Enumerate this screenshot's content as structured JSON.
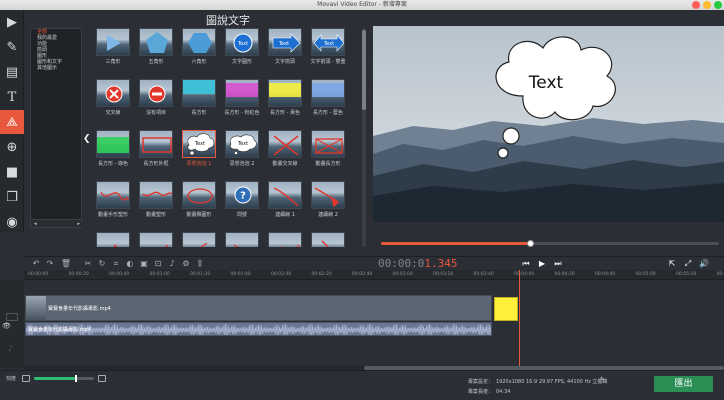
{
  "window": {
    "title": "Movavi Video Editor - 新增專案"
  },
  "panel": {
    "title": "圖說文字",
    "categories": [
      {
        "label": "全部",
        "selected": true
      },
      {
        "label": "我的最愛",
        "selected": false
      },
      {
        "label": "功能",
        "selected": false
      },
      {
        "label": "箭頭",
        "selected": false
      },
      {
        "label": "圖形",
        "selected": false
      },
      {
        "label": "圖形和文字",
        "selected": false
      },
      {
        "label": "其他圖示",
        "selected": false
      }
    ],
    "tiles": [
      {
        "label": "三角形",
        "kind": "triangle"
      },
      {
        "label": "五角形",
        "kind": "pentagon"
      },
      {
        "label": "六角形",
        "kind": "hexagon"
      },
      {
        "label": "文字圓形",
        "kind": "textcircle"
      },
      {
        "label": "文字箭頭",
        "kind": "textarrow"
      },
      {
        "label": "文字箭頭 - 雙重",
        "kind": "textarrow2"
      },
      {
        "label": "交叉線",
        "kind": "xcircle"
      },
      {
        "label": "沒有項目",
        "kind": "nogo"
      },
      {
        "label": "長方形",
        "kind": "rect-cyan"
      },
      {
        "label": "長方形 - 粉紅色",
        "kind": "rect-pink"
      },
      {
        "label": "長方形 - 黃色",
        "kind": "rect-yellow"
      },
      {
        "label": "長方形 - 藍色",
        "kind": "rect-blue"
      },
      {
        "label": "長方形 - 綠色",
        "kind": "rect-green"
      },
      {
        "label": "長方形外框",
        "kind": "rect-outline"
      },
      {
        "label": "思想泡泡 1",
        "kind": "bubble1",
        "selected": true
      },
      {
        "label": "思想泡泡 2",
        "kind": "bubble2"
      },
      {
        "label": "動畫交叉線",
        "kind": "xlines"
      },
      {
        "label": "動畫長方形",
        "kind": "xrect"
      },
      {
        "label": "動畫手形塑形",
        "kind": "scribble1"
      },
      {
        "label": "動畫塑形",
        "kind": "scribble2"
      },
      {
        "label": "動畫橢圓形",
        "kind": "oval"
      },
      {
        "label": "問號",
        "kind": "question"
      },
      {
        "label": "連續線 1",
        "kind": "line1"
      },
      {
        "label": "連續線 2",
        "kind": "line2"
      },
      {
        "label": "",
        "kind": "arrow-a"
      },
      {
        "label": "",
        "kind": "arrow-b"
      },
      {
        "label": "",
        "kind": "arrow-c"
      },
      {
        "label": "",
        "kind": "arrow-d"
      },
      {
        "label": "",
        "kind": "arrow-e"
      },
      {
        "label": "",
        "kind": "arrow-f"
      }
    ]
  },
  "preview": {
    "bubble_text": "Text"
  },
  "player": {
    "time_gray": "00:00:0",
    "time_red": "1.345",
    "progress": 0.44
  },
  "ruler": [
    "00:00:00",
    "00:00:20",
    "00:00:40",
    "00:01:00",
    "00:01:20",
    "00:01:40",
    "00:02:00",
    "00:02:20",
    "00:02:40",
    "00:03:00",
    "00:03:20",
    "00:03:40",
    "00:04:00",
    "00:04:20",
    "00:04:40",
    "00:05:00",
    "00:05:20",
    "00:05:40"
  ],
  "timeline": {
    "video_clip": "寶寶食量年代影攝專影.mp4",
    "audio_clip": "寶寶食量年代影攝專影.mp4"
  },
  "status": {
    "zoom_label": "刻度",
    "zoom_value": 0.68,
    "settings_key": "專案設定：",
    "settings_val": "1920x1080 16:9 29.97 FPS, 44100 Hz 立體聲",
    "length_key": "專案長度：",
    "length_val": "04:34",
    "export_label": "匯出"
  },
  "colors": {
    "accent": "#e8583d",
    "export": "#2b8f55",
    "yellow_clip": "#ffef3a"
  }
}
